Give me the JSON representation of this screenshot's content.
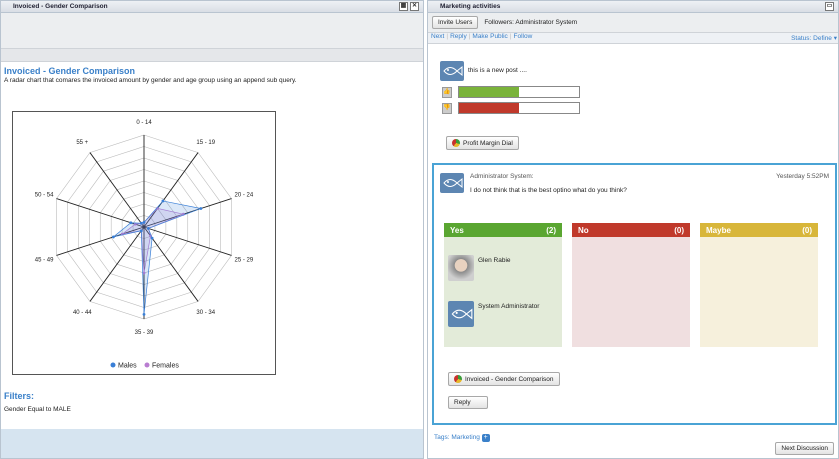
{
  "left_panel": {
    "title": "Invoiced - Gender Comparison",
    "heading": "Invoiced - Gender Comparison",
    "description": "A radar chart that comares the invoiced amount by gender and age group using an append sub query.",
    "filters_title": "Filters:",
    "filters_text": "Gender Equal to MALE"
  },
  "chart_data": {
    "type": "radar",
    "categories": [
      "0 - 14",
      "15 - 19",
      "20 - 24",
      "25 - 29",
      "30 - 34",
      "35 - 39",
      "40 - 44",
      "45 - 49",
      "50 - 54",
      "55 +"
    ],
    "series": [
      {
        "name": "Males",
        "color": "#3a7fd6",
        "values": [
          0.05,
          0.35,
          0.65,
          0.05,
          0.15,
          0.95,
          0.05,
          0.35,
          0.15,
          0.05
        ]
      },
      {
        "name": "Females",
        "color": "#b97dd1",
        "values": [
          0.05,
          0.25,
          0.45,
          0.05,
          0.12,
          0.5,
          0.05,
          0.25,
          0.1,
          0.05
        ]
      }
    ],
    "legend": "bottom"
  },
  "right_panel": {
    "title": "Marketing activities",
    "invite_button": "Invite Users",
    "followers": "Followers: Administrator System",
    "nav": [
      "Next",
      "Reply",
      "Make Public",
      "Follow"
    ],
    "status": "Status: Define",
    "first_post_text": "this is a new post ....",
    "like_fraction": 0.5,
    "dislike_fraction": 0.5,
    "like_color": "#7ab33a",
    "dislike_color": "#c0392b",
    "profit_button": "Profit Margin Dial",
    "post": {
      "author": "Administrator System:",
      "time": "Yesterday 5:52PM",
      "text": "I do not think that is the best optino what do you think?",
      "columns": [
        {
          "label": "Yes",
          "count": "(2)",
          "head_color": "#5aa631",
          "bg_color": "#e3ebd9"
        },
        {
          "label": "No",
          "count": "(0)",
          "head_color": "#c0392b",
          "bg_color": "#f0dfe0"
        },
        {
          "label": "Maybe",
          "count": "(0)",
          "head_color": "#d8b63a",
          "bg_color": "#f6f0dc"
        }
      ],
      "voters": [
        "Glen Rabie",
        "System Administrator"
      ],
      "attachment_button": "Invoiced - Gender Comparison",
      "reply_button": "Reply"
    },
    "tags": "Tags: Marketing",
    "next_discussion": "Next Discussion"
  }
}
